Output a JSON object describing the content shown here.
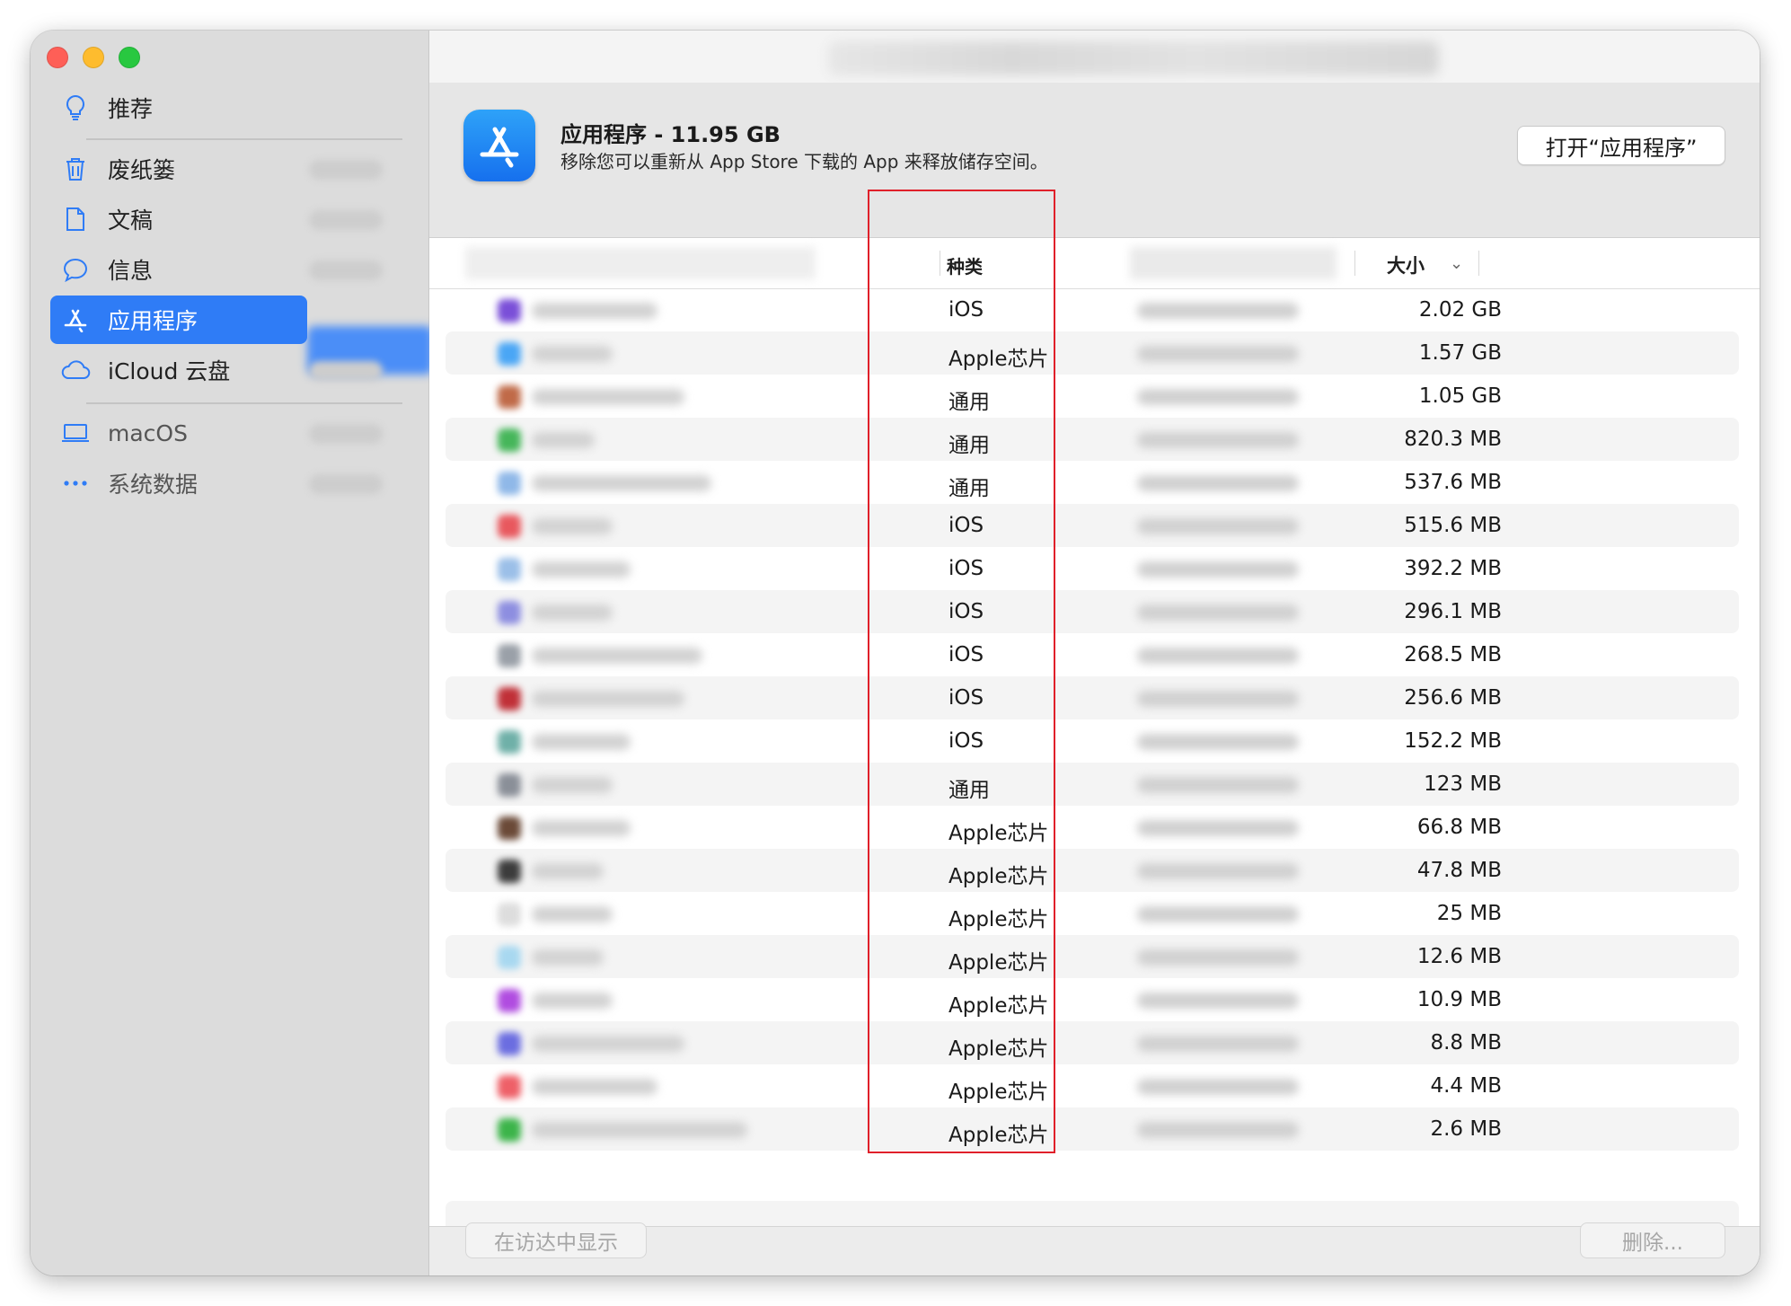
{
  "sidebar": {
    "items": [
      {
        "label": "推荐",
        "icon": "lightbulb-icon"
      },
      {
        "label": "废纸篓",
        "icon": "trash-icon"
      },
      {
        "label": "文稿",
        "icon": "document-icon"
      },
      {
        "label": "信息",
        "icon": "message-bubble-icon"
      },
      {
        "label": "应用程序",
        "icon": "app-store-icon",
        "selected": true
      },
      {
        "label": "iCloud 云盘",
        "icon": "cloud-icon"
      },
      {
        "label": "macOS",
        "icon": "laptop-icon"
      },
      {
        "label": "系统数据",
        "icon": "ellipsis-icon"
      }
    ]
  },
  "header": {
    "title": "应用程序 - 11.95 GB",
    "subtitle": "移除您可以重新从 App Store 下载的 App 来释放储存空间。",
    "open_button": "打开“应用程序”"
  },
  "table": {
    "columns": {
      "kind": "种类",
      "size": "大小"
    },
    "rows": [
      {
        "kind": "iOS",
        "size": "2.02 GB"
      },
      {
        "kind": "Apple芯片",
        "size": "1.57 GB"
      },
      {
        "kind": "通用",
        "size": "1.05 GB"
      },
      {
        "kind": "通用",
        "size": "820.3 MB"
      },
      {
        "kind": "通用",
        "size": "537.6 MB"
      },
      {
        "kind": "iOS",
        "size": "515.6 MB"
      },
      {
        "kind": "iOS",
        "size": "392.2 MB"
      },
      {
        "kind": "iOS",
        "size": "296.1 MB"
      },
      {
        "kind": "iOS",
        "size": "268.5 MB"
      },
      {
        "kind": "iOS",
        "size": "256.6 MB"
      },
      {
        "kind": "iOS",
        "size": "152.2 MB"
      },
      {
        "kind": "通用",
        "size": "123 MB"
      },
      {
        "kind": "Apple芯片",
        "size": "66.8 MB"
      },
      {
        "kind": "Apple芯片",
        "size": "47.8 MB"
      },
      {
        "kind": "Apple芯片",
        "size": "25 MB"
      },
      {
        "kind": "Apple芯片",
        "size": "12.6 MB"
      },
      {
        "kind": "Apple芯片",
        "size": "10.9 MB"
      },
      {
        "kind": "Apple芯片",
        "size": "8.8 MB"
      },
      {
        "kind": "Apple芯片",
        "size": "4.4 MB"
      },
      {
        "kind": "Apple芯片",
        "size": "2.6 MB"
      }
    ]
  },
  "footer": {
    "show_in_finder": "在访达中显示",
    "delete": "删除..."
  },
  "colors": {
    "accent": "#2f7cf6",
    "highlight_box": "#e0202a",
    "sidebar_bg": "#dcdcdc"
  }
}
